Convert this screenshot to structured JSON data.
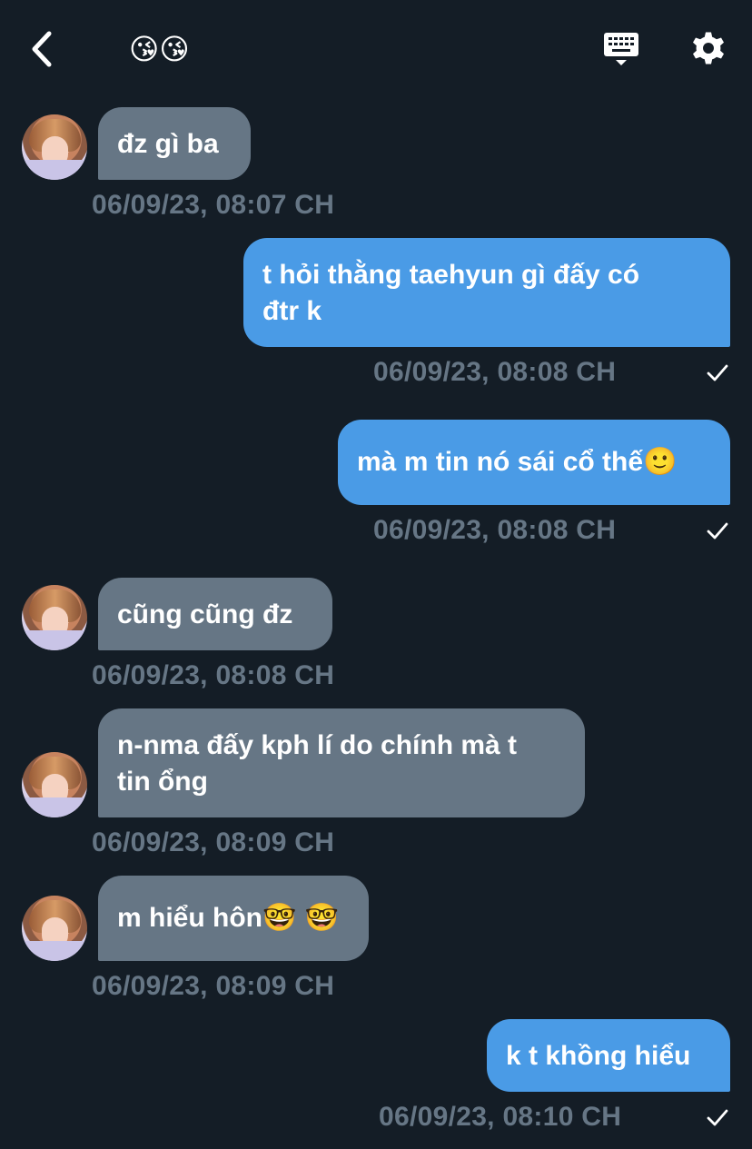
{
  "header": {
    "title_emoji": "😘😘",
    "back_icon": "chevron-left-icon",
    "keyboard_icon": "keyboard-icon",
    "settings_icon": "gear-icon"
  },
  "messages": [
    {
      "direction": "in",
      "text": "đz gì ba",
      "timestamp": "06/09/23, 08:07 CH"
    },
    {
      "direction": "out",
      "text_line1": "t hỏi thằng taehyun gì đấy có",
      "text_line2": "đtr k",
      "timestamp": "06/09/23, 08:08 CH",
      "status_icon": "checkmark-icon"
    },
    {
      "direction": "out",
      "text": "mà m tin nó sái cổ thế",
      "emoji": "🙂",
      "timestamp": "06/09/23, 08:08 CH",
      "status_icon": "checkmark-icon"
    },
    {
      "direction": "in",
      "text": "cũng cũng đz",
      "timestamp": "06/09/23, 08:08 CH"
    },
    {
      "direction": "in",
      "text_line1": "n-nma đấy kph lí do chính mà t",
      "text_line2": "tin ổng",
      "timestamp": "06/09/23, 08:09 CH"
    },
    {
      "direction": "in",
      "text": "m hiểu hôn",
      "emoji": "🤓 🤓",
      "timestamp": "06/09/23, 08:09 CH"
    },
    {
      "direction": "out",
      "text": "k t khồng hiểu",
      "timestamp": "06/09/23, 08:10 CH",
      "status_icon": "checkmark-icon"
    }
  ],
  "colors": {
    "background": "#141d26",
    "incoming_bubble": "#667685",
    "outgoing_bubble": "#4a9be6",
    "timestamp": "#667685",
    "text": "#ffffff"
  }
}
